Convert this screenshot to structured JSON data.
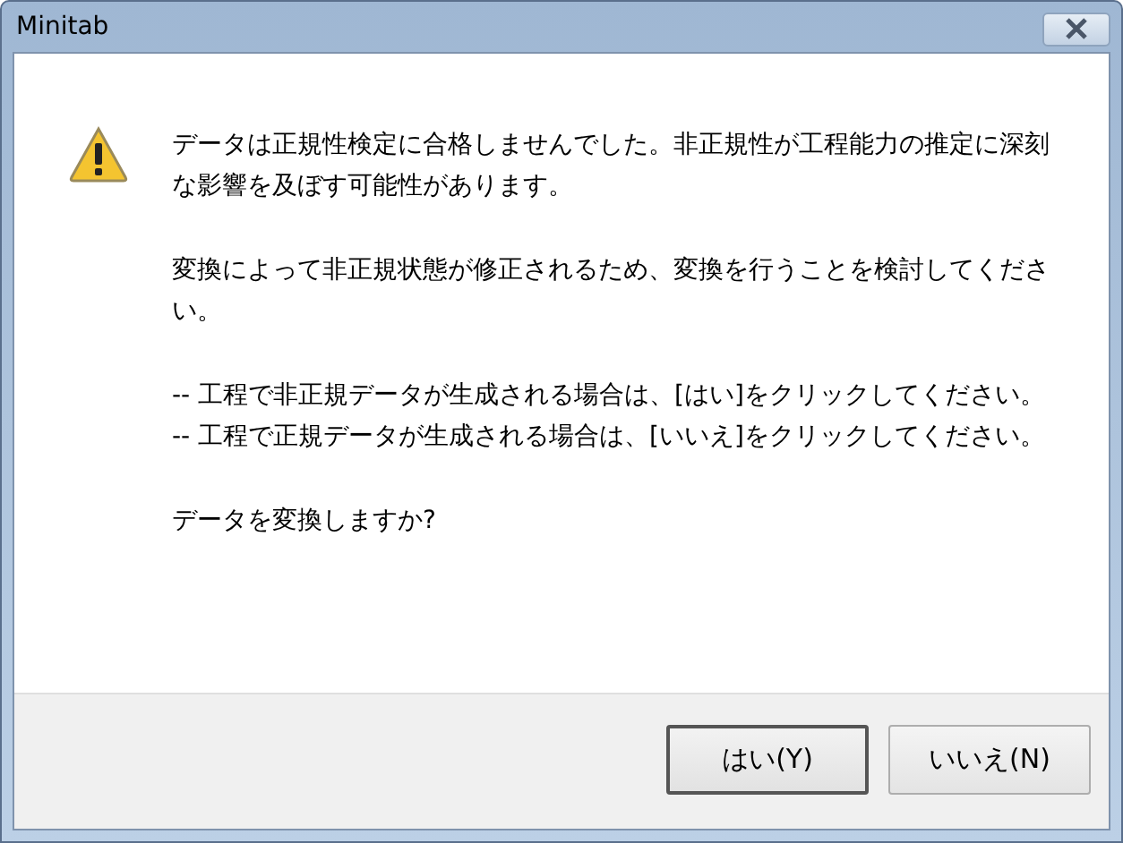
{
  "window": {
    "title": "Minitab"
  },
  "message": [
    [
      "データは正規性検定に合格しませんでした。非正規性が工程能力の推定に深刻な影響を及ぼす可能性があります。"
    ],
    [
      "変換によって非正規状態が修正されるため、変換を行うことを検討してください。"
    ],
    [
      "-- 工程で非正規データが生成される場合は、[はい]をクリックしてください。",
      "-- 工程で正規データが生成される場合は、[いいえ]をクリックしてください。"
    ],
    [
      "データを変換しますか?"
    ]
  ],
  "buttons": [
    {
      "label": "はい(Y)",
      "selected": true
    },
    {
      "label": "いいえ(N)",
      "selected": false
    }
  ]
}
